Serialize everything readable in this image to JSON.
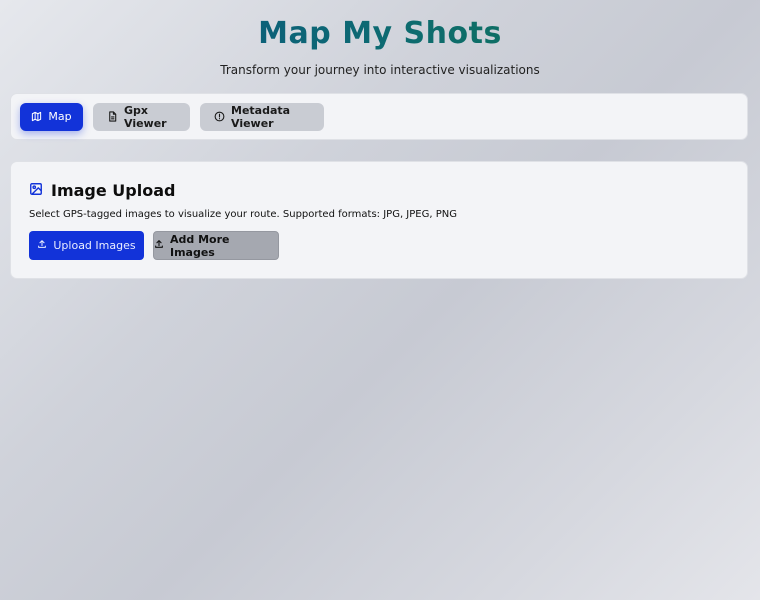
{
  "header": {
    "title": "Map My Shots",
    "subtitle": "Transform your journey into interactive visualizations"
  },
  "tabs": [
    {
      "label": "Map",
      "icon": "map-icon",
      "active": true
    },
    {
      "label": "Gpx Viewer",
      "icon": "file-icon",
      "active": false
    },
    {
      "label": "Metadata Viewer",
      "icon": "info-icon",
      "active": false
    }
  ],
  "upload_card": {
    "title": "Image Upload",
    "icon": "image-icon",
    "description": "Select GPS-tagged images to visualize your route. Supported formats: JPG, JPEG, PNG",
    "upload_button": {
      "label": "Upload Images",
      "icon": "upload-icon"
    },
    "add_more_button": {
      "label": "Add More Images",
      "icon": "upload-icon"
    }
  },
  "colors": {
    "accent": "#1233d9",
    "title_gradient_start": "#0b4f86",
    "title_gradient_end": "#12784a"
  }
}
